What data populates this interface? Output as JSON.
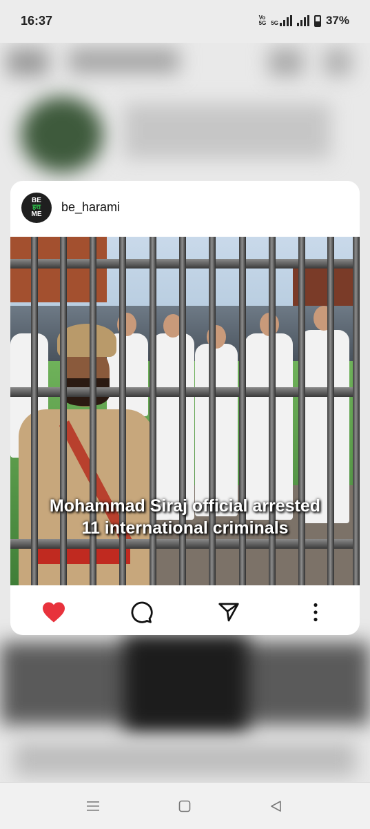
{
  "status_bar": {
    "time": "16:37",
    "network_top": "Vo",
    "network_bottom": "5G",
    "net_type": "5G",
    "battery": "37%"
  },
  "post": {
    "avatar_top": "BE",
    "avatar_mid": "हरा",
    "avatar_bottom": "ME",
    "username": "be_harami",
    "caption_line1": "Mohammad Siraj official arrested",
    "caption_line2": "11 international criminals",
    "liked": true,
    "like_color": "#e8323c"
  },
  "icons": {
    "like": "heart-icon",
    "comment": "comment-icon",
    "share": "send-icon",
    "more": "more-vertical-icon"
  },
  "nav": {
    "recents": "menu-icon",
    "home": "square-icon",
    "back": "triangle-back-icon"
  }
}
